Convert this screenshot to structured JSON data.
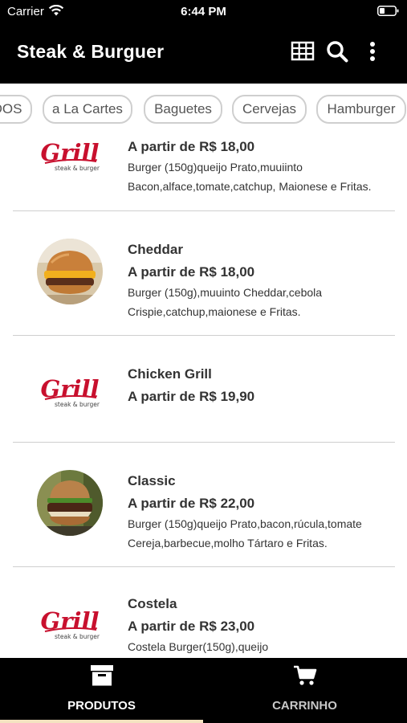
{
  "status_bar": {
    "carrier": "Carrier",
    "time": "6:44 PM"
  },
  "app_bar": {
    "title": "Steak & Burguer"
  },
  "categories": [
    "DOS",
    "a La Cartes",
    "Baguetes",
    "Cervejas",
    "Hamburger"
  ],
  "logo": {
    "script": "Grill",
    "tagline": "steak & burger"
  },
  "products": [
    {
      "name": "",
      "price": "A partir de R$ 18,00",
      "description": "Burger (150g)queijo Prato,muuiinto Bacon,alface,tomate,catchup, Maionese e Fritas.",
      "image": "grill-logo"
    },
    {
      "name": "Cheddar",
      "price": "A partir de R$ 18,00",
      "description": "Burger (150g),muuinto Cheddar,cebola Crispie,catchup,maionese e Fritas.",
      "image": "cheddar-burger-photo"
    },
    {
      "name": "Chicken Grill",
      "price": "A partir de R$ 19,90",
      "description": "",
      "image": "grill-logo"
    },
    {
      "name": "Classic",
      "price": "A partir de R$ 22,00",
      "description": "Burger (150g)queijo Prato,bacon,rúcula,tomate Cereja,barbecue,molho Tártaro e Fritas.",
      "image": "classic-burger-photo"
    },
    {
      "name": "Costela",
      "price": "A partir de R$ 23,00",
      "description": "Costela Burger(150g),queijo",
      "image": "grill-logo"
    }
  ],
  "bottom_nav": {
    "tabs": [
      {
        "label": "PRODUTOS",
        "icon": "archive-box-icon",
        "active": true
      },
      {
        "label": "CARRINHO",
        "icon": "shopping-cart-icon",
        "active": false
      }
    ]
  },
  "colors": {
    "bar": "#000000",
    "brand_red": "#c8102e",
    "active_indicator": "#f4e3c1",
    "inactive_tab": "#9a9a9a"
  }
}
